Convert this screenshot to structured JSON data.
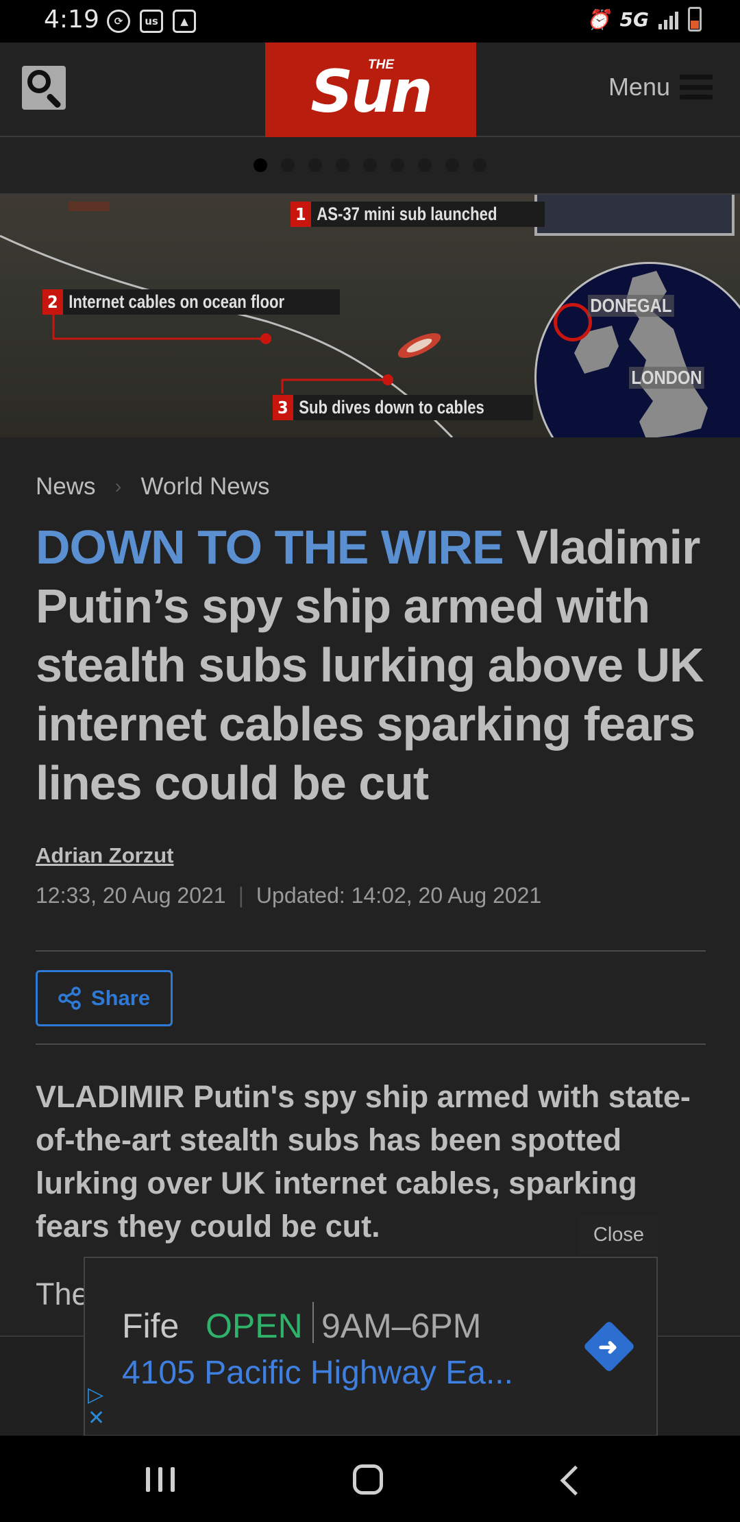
{
  "status_bar": {
    "time": "4:19",
    "network": "5G",
    "left_icons": [
      "sync-icon",
      "us-badge-icon",
      "gallery-icon"
    ],
    "right_icons": [
      "alarm-icon",
      "signal-icon",
      "battery-icon"
    ],
    "us_badge": "us"
  },
  "header": {
    "logo_small": "THE",
    "logo_main": "Sun",
    "menu_label": "Menu"
  },
  "carousel": {
    "slide_count": 9,
    "active_index": 0
  },
  "hero": {
    "callouts": [
      {
        "num": "1",
        "text": "AS-37 mini sub launched"
      },
      {
        "num": "2",
        "text": "Internet cables on ocean floor"
      },
      {
        "num": "3",
        "text": "Sub dives down to cables"
      }
    ],
    "map_labels": {
      "north": "DONEGAL",
      "south": "LONDON"
    }
  },
  "breadcrumb": {
    "items": [
      "News",
      "World News"
    ],
    "separator": "›"
  },
  "article": {
    "kicker": "DOWN TO THE WIRE",
    "headline": "Vladimir Putin’s spy ship armed with stealth subs lurking above UK internet cables sparking fears lines could be cut",
    "author": "Adrian Zorzut",
    "published": "12:33, 20 Aug 2021",
    "date_separator": "|",
    "updated": "Updated: 14:02, 20 Aug 2021",
    "share_label": "Share",
    "lead": "VLADIMIR Putin's spy ship armed with state-of-the-art stealth subs has been spotted lurking over UK internet cables, sparking fears they could be cut.",
    "next_paragraph_start": "The"
  },
  "ad": {
    "close_label": "Close",
    "business_name": "Fife",
    "status": "OPEN",
    "hours": "9AM–6PM",
    "address": "4105 Pacific Highway Ea...",
    "adchoices_icons": [
      "adchoices-icon",
      "close-ad-icon"
    ]
  },
  "colors": {
    "brand_red": "#b81d0e",
    "kicker_blue": "#5a8fd1",
    "link_blue": "#2f7ad6",
    "open_green": "#2fb36b",
    "background": "#222222"
  }
}
